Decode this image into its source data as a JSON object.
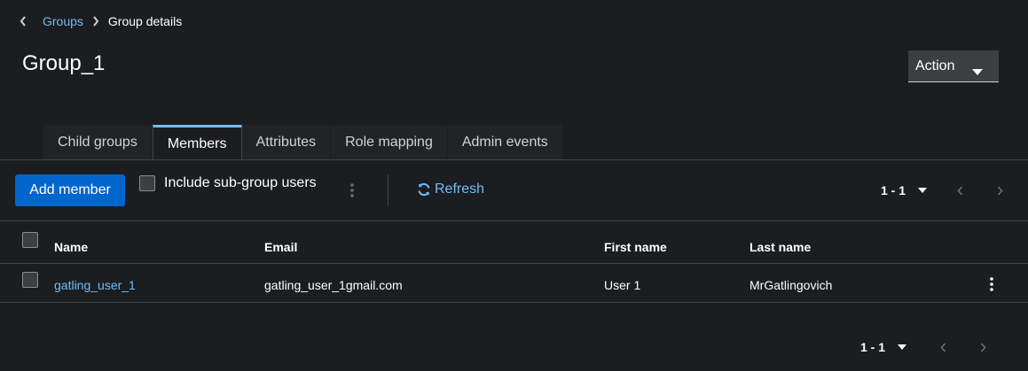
{
  "breadcrumb": {
    "parent": "Groups",
    "current": "Group details"
  },
  "page": {
    "title": "Group_1",
    "action_label": "Action"
  },
  "tabs": [
    {
      "label": "Child groups",
      "active": false
    },
    {
      "label": "Members",
      "active": true
    },
    {
      "label": "Attributes",
      "active": false
    },
    {
      "label": "Role mapping",
      "active": false
    },
    {
      "label": "Admin events",
      "active": false
    }
  ],
  "toolbar": {
    "add_member_label": "Add member",
    "include_subgroup_label": "Include sub-group users",
    "refresh_label": "Refresh"
  },
  "pagination": {
    "range": "1 - 1"
  },
  "table": {
    "columns": [
      "Name",
      "Email",
      "First name",
      "Last name"
    ],
    "rows": [
      {
        "name": "gatling_user_1",
        "email": "gatling_user_1gmail.com",
        "first_name": "User 1",
        "last_name": "MrGatlingovich"
      }
    ]
  },
  "colors": {
    "background": "#1b1d21",
    "link": "#73bcf7",
    "primary": "#0066cc",
    "border": "#444548"
  }
}
